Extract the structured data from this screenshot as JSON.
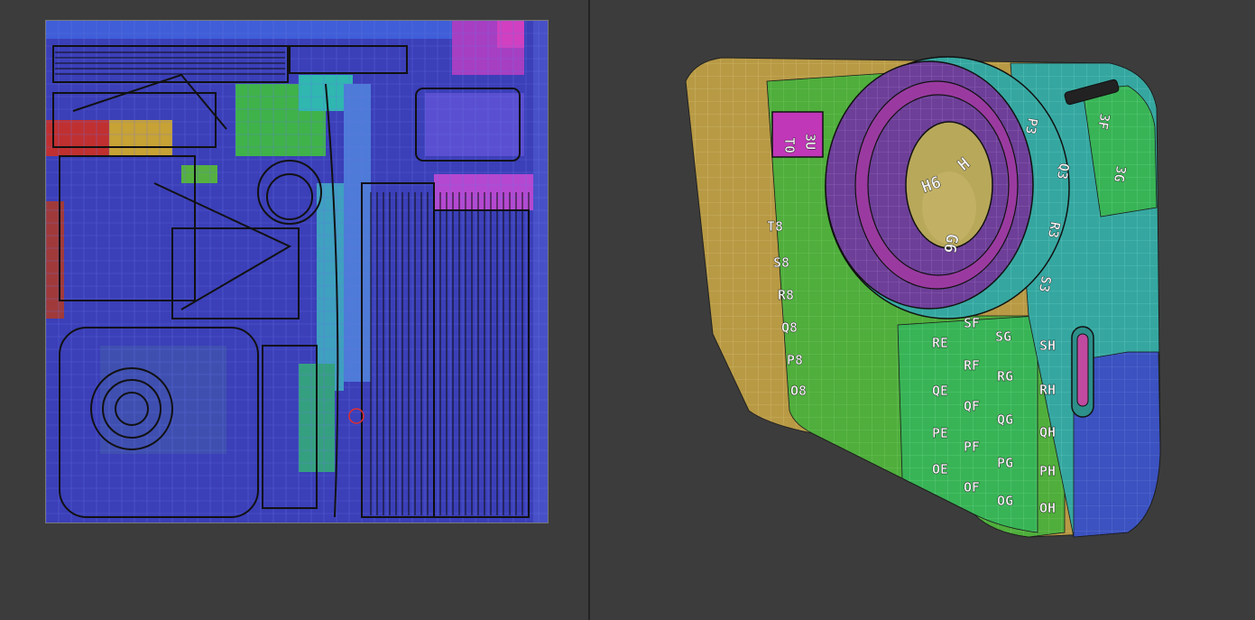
{
  "uv_editor": {
    "checker_colors": {
      "base": "#3b3fb8",
      "grid": "#5a62e0",
      "island_outline": "#111111",
      "accent_green": "#3fb24a",
      "accent_cyan": "#2fb7b0",
      "accent_magenta": "#c030c8",
      "accent_orange": "#d09030",
      "accent_red": "#c03030"
    }
  },
  "viewport": {
    "model": "camera",
    "tile_labels": {
      "left_face": [
        "T8",
        "S8",
        "R8",
        "Q8",
        "P8",
        "O8"
      ],
      "lens_ring": [
        "H6",
        "H",
        "G6"
      ],
      "front_top": [
        "T0",
        "3U"
      ],
      "right_upper": [
        "P3",
        "Q3",
        "R3",
        "S3",
        "3F",
        "3G"
      ],
      "front_grid_row1": [
        "SF",
        "SG"
      ],
      "front_grid_row2": [
        "RE",
        "RF",
        "RG"
      ],
      "front_grid_row3": [
        "QE",
        "QF",
        "QG"
      ],
      "front_grid_row4": [
        "PE",
        "PF",
        "PG"
      ],
      "front_grid_row5": [
        "OE",
        "OF",
        "OG"
      ],
      "right_column": [
        "SH",
        "RH",
        "QH",
        "PH",
        "OH"
      ]
    },
    "colors": {
      "background": "#3c3c3c",
      "face_yellow": "#b89a45",
      "face_green": "#4fae3c",
      "face_green2": "#38b456",
      "face_teal": "#35a7a0",
      "face_blue": "#3b52c0",
      "ring_purple": "#6d3f98",
      "ring_magenta": "#9a3aa0",
      "lens_inner": "#b8a85a"
    }
  }
}
